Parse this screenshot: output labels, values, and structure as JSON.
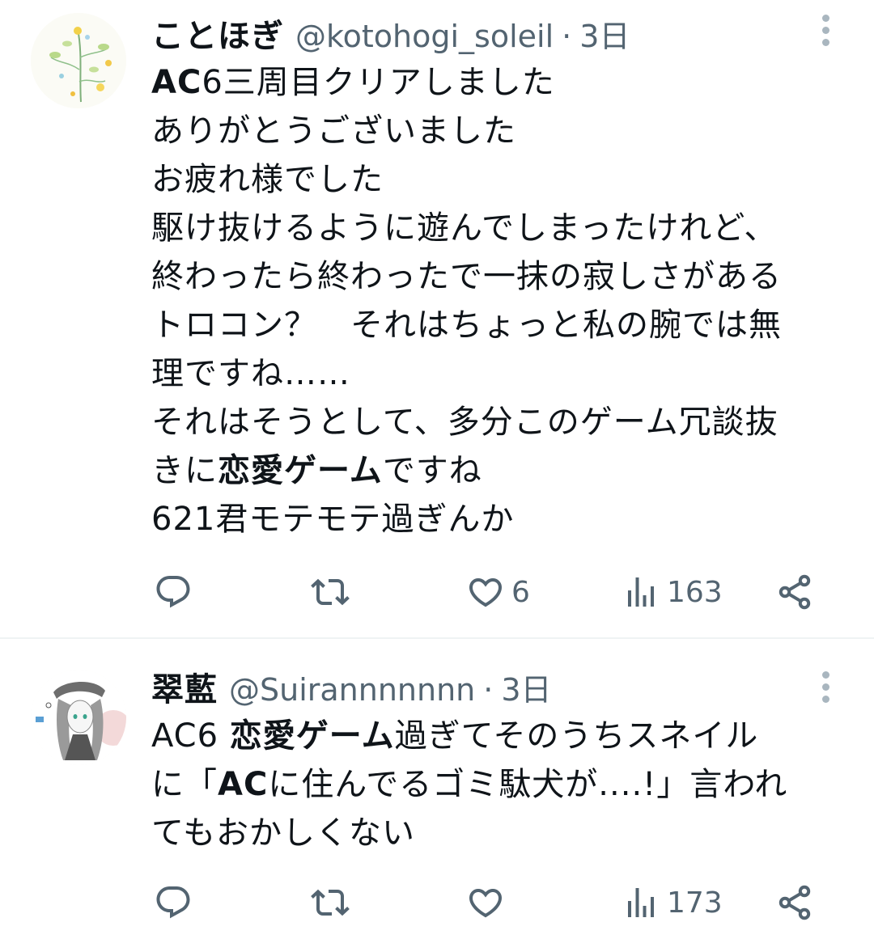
{
  "tweets": [
    {
      "name": "ことほぎ",
      "handle": "@kotohogi_soleil",
      "separator": "·",
      "time": "3日",
      "lines": [
        [
          {
            "t": "AC",
            "b": true
          },
          {
            "t": "6三周目クリアしました"
          }
        ],
        [
          {
            "t": "ありがとうございました"
          }
        ],
        [
          {
            "t": "お疲れ様でした"
          }
        ],
        [
          {
            "t": "駆け抜けるように遊んでしまったけれど、"
          }
        ],
        [
          {
            "t": "終わったら終わったで一抹の寂しさがある"
          }
        ],
        [
          {
            "t": "トロコン？　それはちょっと私の腕では無"
          }
        ],
        [
          {
            "t": "理ですね……"
          }
        ],
        [
          {
            "t": "それはそうとして、多分このゲーム冗談抜"
          }
        ],
        [
          {
            "t": "きに"
          },
          {
            "t": "恋愛ゲーム",
            "b": true
          },
          {
            "t": "ですね"
          }
        ],
        [
          {
            "t": "621君モテモテ過ぎんか"
          }
        ]
      ],
      "actions": {
        "reply": "",
        "retweet": "",
        "like": "6",
        "views": "163"
      }
    },
    {
      "name": "翠藍",
      "handle": "@Suirannnnnnn",
      "separator": "·",
      "time": "3日",
      "lines": [
        [
          {
            "t": "AC6 "
          },
          {
            "t": "恋愛ゲーム",
            "b": true
          },
          {
            "t": "過ぎてそのうちスネイル"
          }
        ],
        [
          {
            "t": "に「"
          },
          {
            "t": "AC",
            "b": true
          },
          {
            "t": "に住んでるゴミ駄犬が....!」言われ"
          }
        ],
        [
          {
            "t": "てもおかしくない"
          }
        ]
      ],
      "actions": {
        "reply": "",
        "retweet": "",
        "like": "",
        "views": "173"
      }
    }
  ],
  "icons": [
    "reply-icon",
    "retweet-icon",
    "like-icon",
    "views-icon",
    "share-icon",
    "more-icon"
  ],
  "colors": {
    "text": "#0f1419",
    "secondary": "#536471",
    "divider": "#eff3f4"
  }
}
